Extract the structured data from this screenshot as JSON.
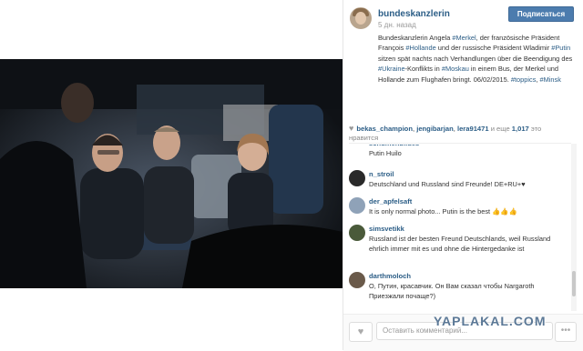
{
  "post": {
    "username": "bundeskanzlerin",
    "time_ago": "5 дн. назад",
    "follow_label": "Подписаться",
    "caption": {
      "p1": "Bundeskanzlerin Angela ",
      "t1": "#Merkel",
      "p2": ", der französische Präsident François ",
      "t2": "#Hollande",
      "p3": " und der russische Präsident Wladimir ",
      "t3": "#Putin",
      "p4": " sitzen spät nachts nach Verhandlungen über die Beendigung des ",
      "t4": "#Ukraine",
      "p5": "-Konflikts in ",
      "t5": "#Moskau",
      "p6": " in einem Bus, der Merkel und Hollande zum Flughafen bringt. 06/02/2015. ",
      "t6": "#toppics",
      "p7": ", ",
      "t7": "#Minsk"
    }
  },
  "likes": {
    "users": [
      "bekas_champion",
      "jengibarjan",
      "lera91471"
    ],
    "sep1": ", ",
    "sep2": ", ",
    "more_prefix": " и еще ",
    "count": "1,017",
    "more_suffix": " это",
    "more_line2": "нравится"
  },
  "comments": [
    {
      "user": "schumenbildes",
      "text": "Putin Huilo",
      "avatar_color": "#5a3a3a"
    },
    {
      "user": "n_stroil",
      "text": "Deutschland und Russland sind Freunde! DE+RU+♥",
      "avatar_color": "#2a2a2a"
    },
    {
      "user": "der_apfelsaft",
      "text": "It is only normal photo... Putin is the best 👍👍👍",
      "avatar_color": "#8fa2b8"
    },
    {
      "user": "simsvetikk",
      "text": "Russland ist der besten Freund Deutschlands, weil Russland ehrlich immer mit es und ohne die Hintergedanke ist",
      "avatar_color": "#4a5a3a"
    },
    {
      "user": "darthmoloch",
      "text": "О, Путин, красавчик. Он Вам сказал чтобы Nargaroth Приезжали почаще?)",
      "avatar_color": "#6a5a4a"
    }
  ],
  "bottom": {
    "heart_icon": "♥",
    "comment_placeholder": "Оставить комментарий...",
    "more_icon": "•••"
  },
  "watermark": "YAPLAKAL.COM",
  "colors": {
    "link": "#2b5d86",
    "follow_button": "#4c7cae"
  }
}
